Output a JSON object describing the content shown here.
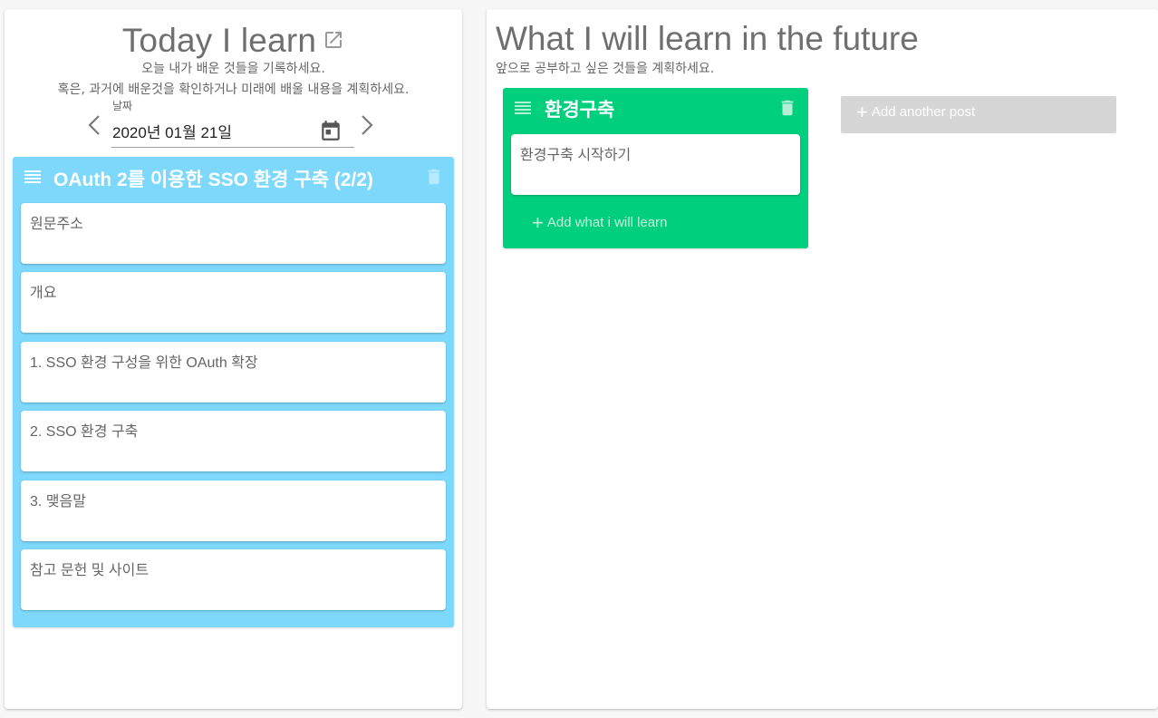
{
  "left": {
    "title": "Today I learn",
    "subtitle_1": "오늘 내가 배운 것들을 기록하세요.",
    "subtitle_2": "혹은, 과거에 배운것을 확인하거나 미래에 배울 내용을 계획하세요.",
    "date": {
      "label": "날짜",
      "value": "2020년 01월 21일"
    },
    "board": {
      "title": "OAuth 2를 이용한 SSO 환경 구축 (2/2)",
      "color": "#7dd8fb",
      "cards": [
        "원문주소",
        "개요",
        "1. SSO 환경 구성을 위한 OAuth 확장",
        "2. SSO 환경 구축",
        "3. 맺음말",
        "참고 문헌 및 사이트"
      ]
    }
  },
  "right": {
    "title": "What I will learn in the future",
    "subtitle": "앞으로 공부하고 싶은 것들을 계획하세요.",
    "board": {
      "title": "환경구축",
      "color": "#00cf7e",
      "cards": [
        "환경구축 시작하기"
      ],
      "add_label": "Add what i will learn"
    },
    "add_post_label": "Add another post"
  },
  "icons": {
    "external_link": "open-in-new-icon",
    "prev": "chevron-left-icon",
    "next": "chevron-right-icon",
    "calendar": "calendar-icon",
    "drag": "drag-handle-icon",
    "delete": "trash-icon",
    "add": "plus-icon"
  }
}
